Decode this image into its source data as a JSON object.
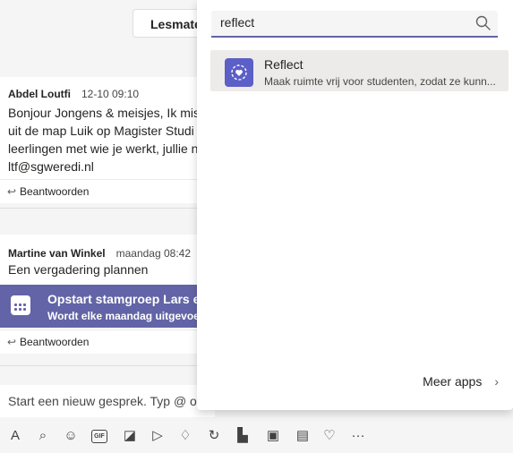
{
  "top_pill": "Lesmate",
  "messages": [
    {
      "author": "Abdel Loutfi",
      "time": "12-10 09:10",
      "lines": [
        "Bonjour Jongens & meisjes, Ik mis",
        "uit de map Luik op Magister Studi",
        "leerlingen met wie je werkt, jullie n",
        "ltf@sgweredi.nl"
      ],
      "reply": "Beantwoorden"
    },
    {
      "author": "Martine van Winkel",
      "time": "maandag 08:42",
      "lines": [
        "Een vergadering plannen"
      ],
      "meeting": {
        "title": "Opstart stamgroep Lars en",
        "subtitle": "Wordt elke maandag uitgevoer"
      },
      "reply": "Beantwoorden"
    }
  ],
  "compose_placeholder": "Start een nieuw gesprek. Typ @ om",
  "toolbar_icons": [
    "format-icon",
    "attach-icon",
    "emoji-icon",
    "gif-icon",
    "sticker-icon",
    "send-icon",
    "praise-icon",
    "loop-icon",
    "app1-icon",
    "app2-icon",
    "app3-icon",
    "reflect-icon",
    "more-icon"
  ],
  "search": {
    "value": "reflect"
  },
  "results": [
    {
      "name": "Reflect",
      "description": "Maak ruimte vrij voor studenten, zodat ze kunn..."
    }
  ],
  "more_apps": "Meer apps",
  "colors": {
    "accent": "#6264a7",
    "app_icon": "#5b5fc7"
  }
}
